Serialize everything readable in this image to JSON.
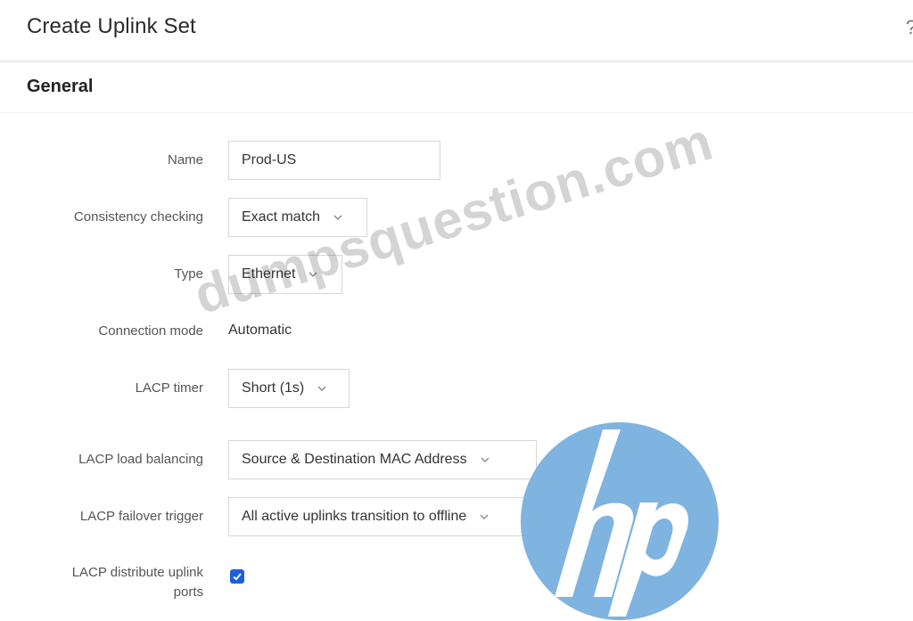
{
  "dialog": {
    "title": "Create Uplink Set",
    "help_icon": "?"
  },
  "section": {
    "title": "General"
  },
  "form": {
    "name": {
      "label": "Name",
      "value": "Prod-US"
    },
    "consistency_checking": {
      "label": "Consistency checking",
      "value": "Exact match"
    },
    "type": {
      "label": "Type",
      "value": "Ethernet"
    },
    "connection_mode": {
      "label": "Connection mode",
      "value": "Automatic"
    },
    "lacp_timer": {
      "label": "LACP timer",
      "value": "Short (1s)"
    },
    "lacp_load_balancing": {
      "label": "LACP load balancing",
      "value": "Source & Destination MAC Address"
    },
    "lacp_failover_trigger": {
      "label": "LACP failover trigger",
      "value": "All active uplinks transition to offline"
    },
    "lacp_distribute_uplink_ports": {
      "label_line1": "LACP distribute uplink",
      "label_line2": "ports",
      "checked": true
    }
  },
  "watermark": {
    "text": "dumpsquestion.com"
  },
  "logo": {
    "text": "hp",
    "color": "#7fb3e0"
  },
  "icons": {
    "dropdown": "chevron-down-icon",
    "checkbox": "checkmark-icon",
    "help": "help-icon"
  },
  "colors": {
    "checkbox_fill": "#1f5fd6",
    "border": "#d6d6d6"
  }
}
